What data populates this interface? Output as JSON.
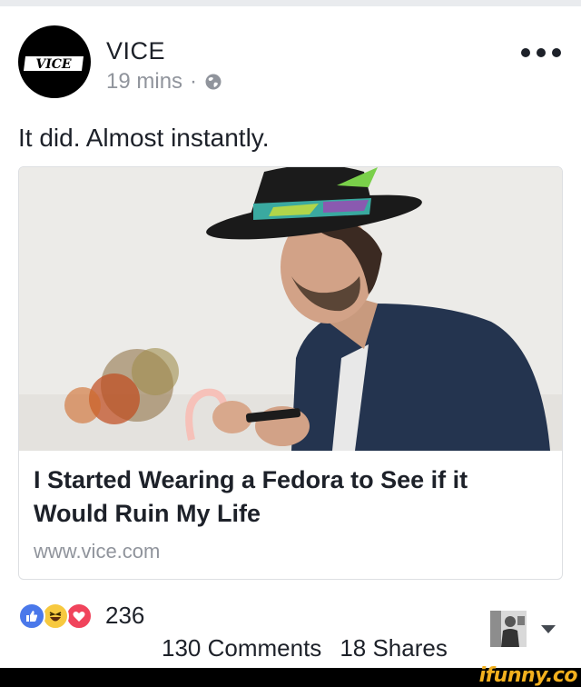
{
  "post": {
    "page_name": "VICE",
    "logo_text": "VICE",
    "time": "19 mins",
    "separator": "·",
    "privacy_icon": "globe-icon",
    "more_icon": "more-dots-icon",
    "text": "It did. Almost instantly."
  },
  "link_card": {
    "image_description_icon": "article-photo",
    "title": "I Started Wearing a Fedora to See if it Would Ruin My Life",
    "domain": "www.vice.com"
  },
  "engagement": {
    "reaction_icons": [
      "like-icon",
      "haha-icon",
      "love-icon"
    ],
    "reaction_count": "236",
    "comments": "130 Comments",
    "shares": "18 Shares"
  },
  "colors": {
    "like": "#4a78ea",
    "haha": "#f7c93f",
    "love": "#f0445c",
    "secondary_text": "#90949c",
    "watermark": "#f2b01e"
  },
  "watermark": {
    "text": "ifunny.co"
  }
}
